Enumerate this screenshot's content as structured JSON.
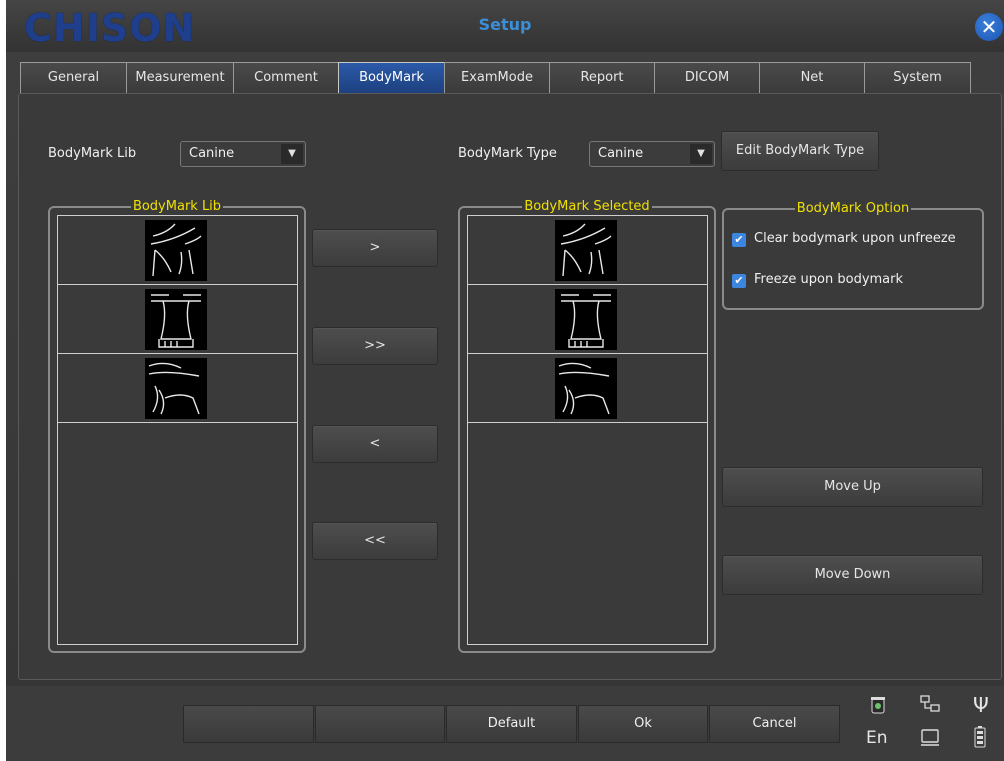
{
  "app": {
    "logo": "CHISON",
    "title": "Setup"
  },
  "tabs": [
    {
      "label": "General",
      "active": false
    },
    {
      "label": "Measurement",
      "active": false
    },
    {
      "label": "Comment",
      "active": false
    },
    {
      "label": "BodyMark",
      "active": true
    },
    {
      "label": "ExamMode",
      "active": false
    },
    {
      "label": "Report",
      "active": false
    },
    {
      "label": "DICOM",
      "active": false
    },
    {
      "label": "Net",
      "active": false
    },
    {
      "label": "System",
      "active": false
    }
  ],
  "bodymark_lib": {
    "label": "BodyMark Lib",
    "value": "Canine"
  },
  "bodymark_type": {
    "label": "BodyMark Type",
    "value": "Canine",
    "edit_button": "Edit BodyMark Type"
  },
  "lib_group": {
    "title": "BodyMark Lib"
  },
  "selected_group": {
    "title": "BodyMark Selected"
  },
  "option_group": {
    "title": "BodyMark Option",
    "options": [
      {
        "label": "Clear bodymark upon unfreeze",
        "checked": true
      },
      {
        "label": "Freeze upon bodymark",
        "checked": true
      }
    ]
  },
  "transfer_buttons": {
    "add": ">",
    "add_all": ">>",
    "remove": "<",
    "remove_all": "<<"
  },
  "move_buttons": {
    "up": "Move Up",
    "down": "Move Down"
  },
  "bottom_buttons": [
    "",
    "",
    "Default",
    "Ok",
    "Cancel"
  ],
  "status": {
    "language": "En"
  },
  "colors": {
    "accent": "#2b5aa8",
    "group_title": "#f0e000",
    "checkbox": "#3d86e0"
  }
}
